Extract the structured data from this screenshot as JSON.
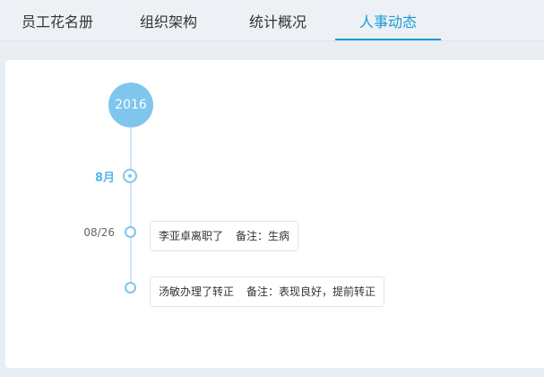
{
  "tabs": [
    {
      "label": "员工花名册",
      "active": false
    },
    {
      "label": "组织架构",
      "active": false
    },
    {
      "label": "统计概况",
      "active": false
    },
    {
      "label": "人事动态",
      "active": true
    }
  ],
  "timeline": {
    "year": "2016",
    "month": "8月",
    "events": [
      {
        "date": "08/26",
        "text": "李亚卓离职了",
        "note": "备注：生病"
      },
      {
        "date": "",
        "text": "汤敏办理了转正",
        "note": "备注：表现良好，提前转正"
      }
    ]
  },
  "colors": {
    "accent": "#1c9bd8",
    "timeline": "#7fc6ee",
    "background": "#e9eef3"
  }
}
